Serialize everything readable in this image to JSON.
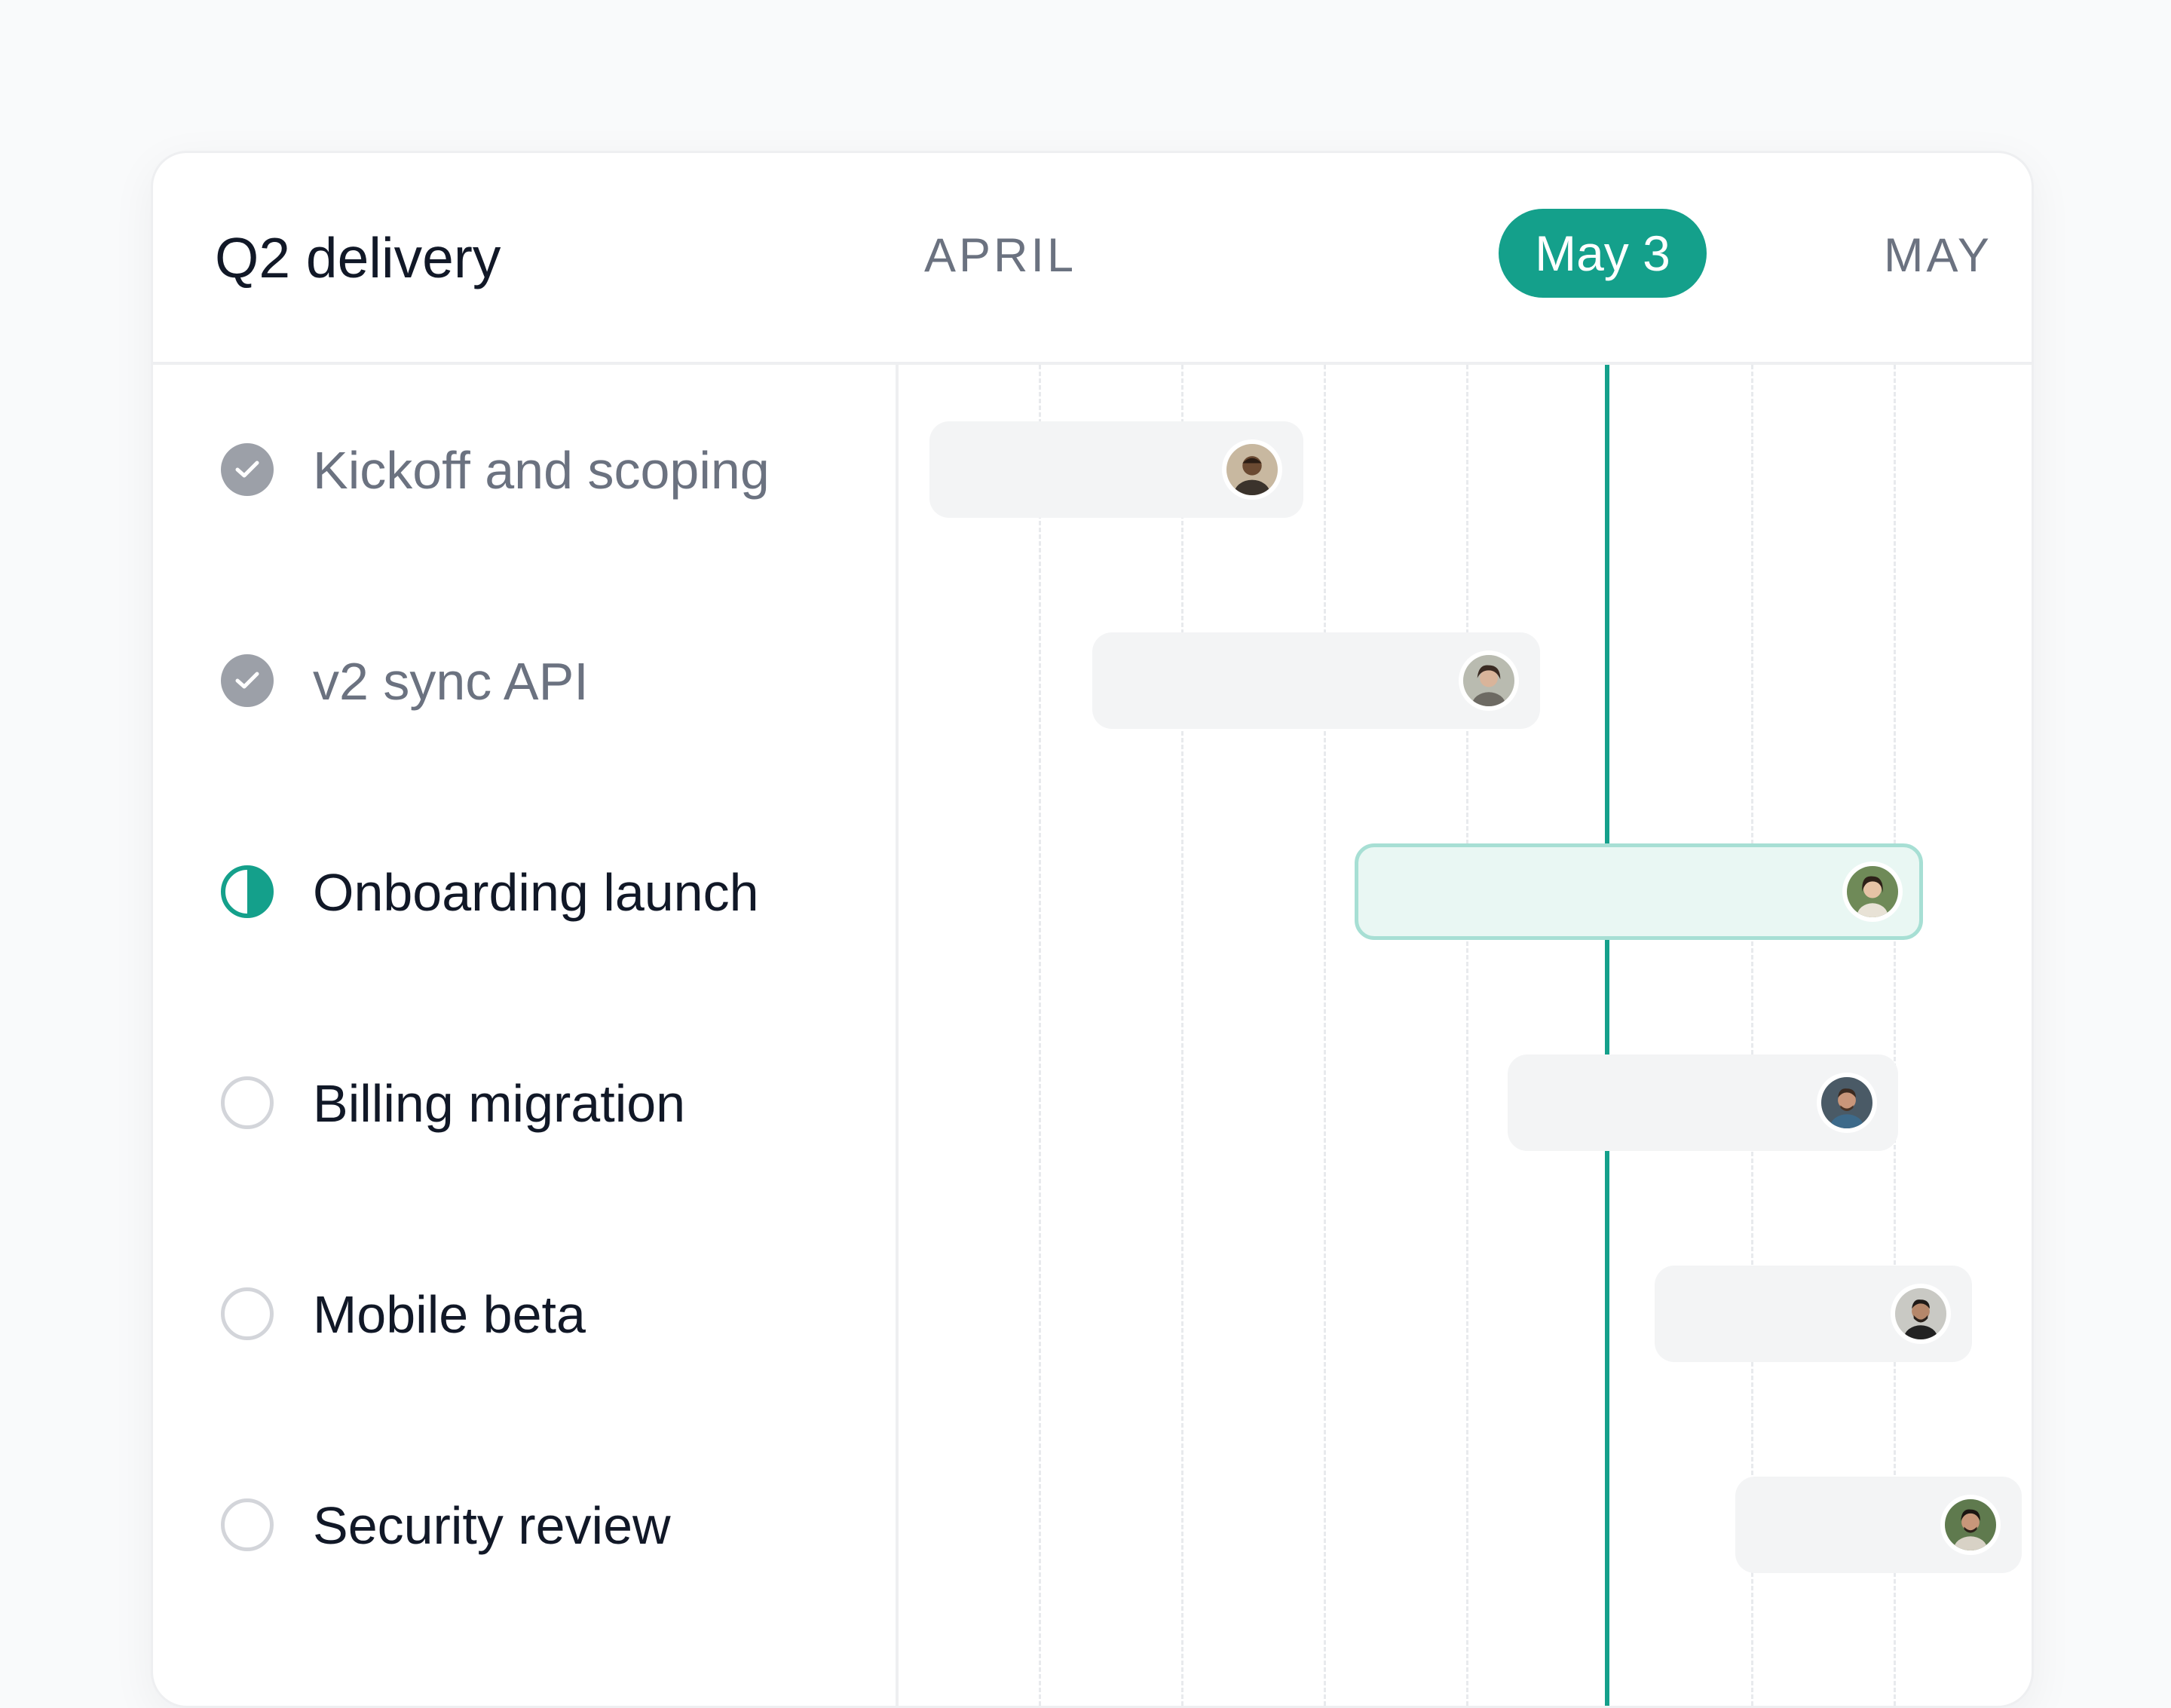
{
  "header": {
    "title": "Q2 delivery",
    "months": [
      "APRIL",
      "MAY"
    ],
    "today_label": "May 3"
  },
  "colors": {
    "accent": "#14a08b",
    "accent_light": "#e9f7f3",
    "done_status": "#9ca0a8"
  },
  "tasks": [
    {
      "label": "Kickoff and scoping",
      "status": "done",
      "avatar": "person-avatar-1"
    },
    {
      "label": "v2 sync API",
      "status": "done",
      "avatar": "person-avatar-2"
    },
    {
      "label": "Onboarding launch",
      "status": "in-progress",
      "avatar": "person-avatar-3"
    },
    {
      "label": "Billing migration",
      "status": "not-started",
      "avatar": "person-avatar-4"
    },
    {
      "label": "Mobile beta",
      "status": "not-started",
      "avatar": "person-avatar-5"
    },
    {
      "label": "Security review",
      "status": "not-started",
      "avatar": "person-avatar-6"
    }
  ]
}
